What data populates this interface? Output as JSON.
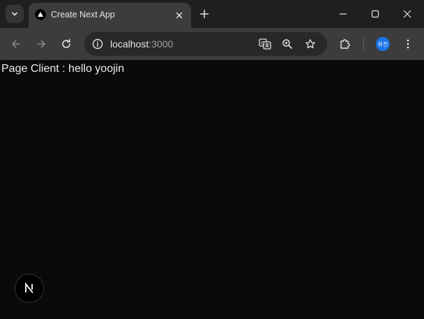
{
  "tab": {
    "title": "Create Next App"
  },
  "address_bar": {
    "host": "localhost",
    "port": ":3000"
  },
  "profile": {
    "initials": "유진"
  },
  "page": {
    "text": "Page Client : hello yoojin"
  },
  "icons": {
    "tab_search": "chevron-down-icon",
    "favicon": "nextjs-triangle-icon",
    "tab_close": "close-icon",
    "new_tab": "plus-icon",
    "minimize": "minimize-icon",
    "maximize": "maximize-icon",
    "window_close": "close-icon",
    "back": "arrow-left-icon",
    "forward": "arrow-right-icon",
    "reload": "reload-icon",
    "site_info": "info-icon",
    "translate": "translate-icon",
    "zoom": "zoom-icon",
    "bookmark": "star-icon",
    "extensions": "puzzle-icon",
    "menu": "kebab-menu-icon",
    "next_dev": "nextjs-n-icon"
  },
  "colors": {
    "frame": "#1f1f1f",
    "toolbar": "#3c3c3c",
    "omnibox": "#282828",
    "page_bg": "#0a0a0a",
    "page_text": "#ededed",
    "avatar": "#1a73e8"
  }
}
